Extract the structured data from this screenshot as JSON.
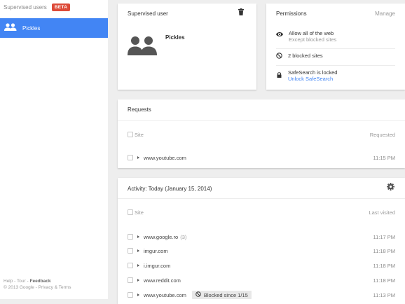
{
  "sidebar": {
    "header": "Supervised users",
    "beta": "BETA",
    "user": "Pickles",
    "footer": {
      "help": "Help",
      "tour": "Tour",
      "feedback": "Feedback",
      "sep": " - ",
      "copyright": "© 2013 Google",
      "privacy": "Privacy & Terms"
    }
  },
  "supervised_card": {
    "title": "Supervised user",
    "name": "Pickles"
  },
  "permissions": {
    "title": "Permissions",
    "manage": "Manage",
    "allow": "Allow all of the web",
    "except": "Except blocked sites",
    "blocked": "2 blocked sites",
    "safesearch": "SafeSearch is locked",
    "unlock": "Unlock SafeSearch"
  },
  "requests": {
    "title": "Requests",
    "col_site": "Site",
    "col_time": "Requested",
    "rows": [
      {
        "site": "www.youtube.com",
        "time": "11:15 PM"
      }
    ]
  },
  "activity": {
    "title": "Activity: Today (January 15, 2014)",
    "col_site": "Site",
    "col_time": "Last visited",
    "rows": [
      {
        "site": "www.google.ro",
        "count": "(3)",
        "time": "11:17 PM"
      },
      {
        "site": "imgur.com",
        "time": "11:18 PM"
      },
      {
        "site": "i.imgur.com",
        "time": "11:18 PM"
      },
      {
        "site": "www.reddit.com",
        "time": "11:18 PM"
      },
      {
        "site": "www.youtube.com",
        "badge": "Blocked since 1/15",
        "time": "11:13 PM"
      }
    ]
  },
  "colors": {
    "accent": "#4285f4",
    "beta": "#dd4b39"
  }
}
